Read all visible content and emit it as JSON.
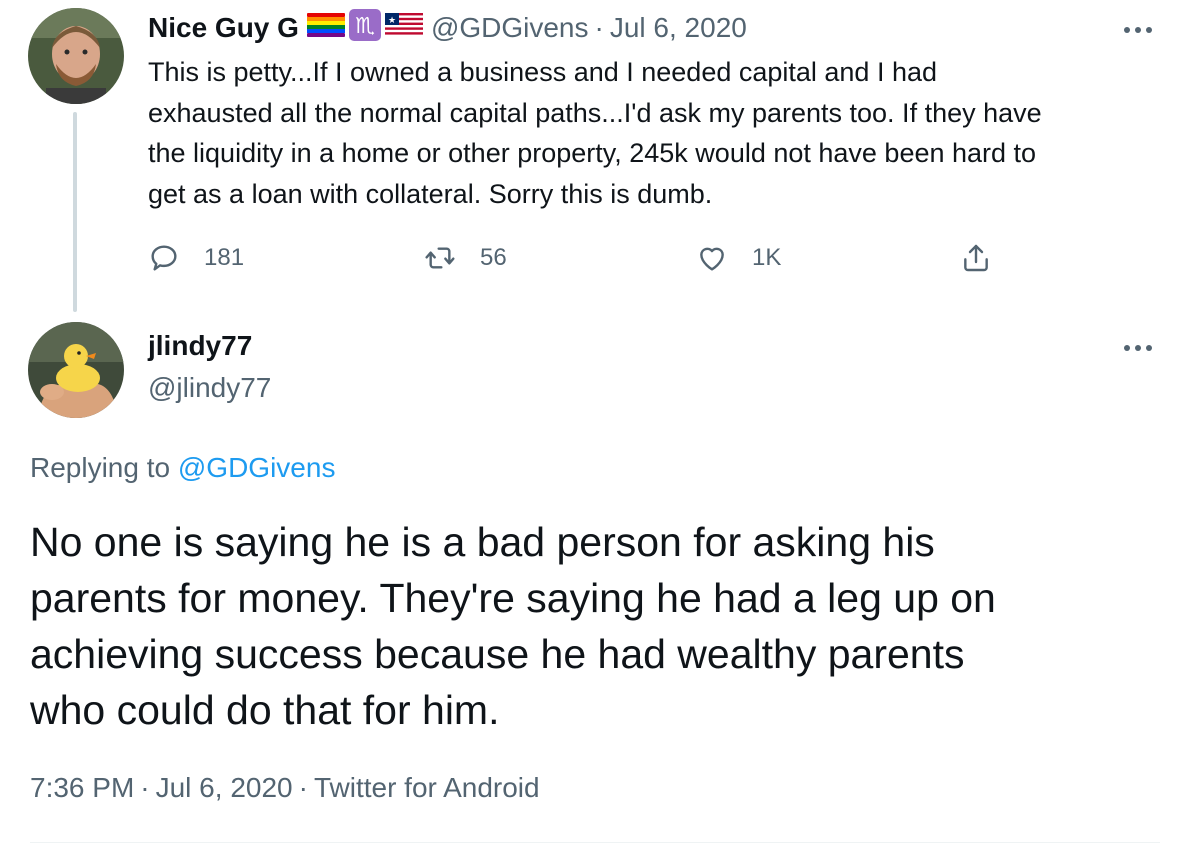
{
  "parent_tweet": {
    "display_name": "Nice Guy G",
    "badges": [
      "rainbow-flag-icon",
      "scorpio-icon",
      "liberia-flag-icon"
    ],
    "handle": "@GDGivens",
    "separator": "·",
    "date": "Jul 6, 2020",
    "lines": [
      "This is petty...If I owned a business and I needed capital and I had",
      "exhausted all the normal capital paths...I'd ask my parents too. If they have",
      "the liquidity in a home or other property, 245k would not have been hard to",
      "get as a loan with collateral. Sorry this is dumb."
    ],
    "actions": {
      "reply_count": "181",
      "retweet_count": "56",
      "like_count": "1K"
    }
  },
  "focal_tweet": {
    "display_name": "jlindy77",
    "handle": "@jlindy77",
    "replying_prefix": "Replying to",
    "replying_to": "@GDGivens",
    "lines": [
      "No one is saying he is a bad person for asking his",
      "parents for money. They're saying he had a leg up on",
      "achieving success because he had wealthy parents",
      "who could do that for him."
    ],
    "time": "7:36 PM",
    "separator": "·",
    "date": "Jul 6, 2020",
    "source": "Twitter for Android"
  },
  "colors": {
    "text_primary": "#0f1419",
    "text_secondary": "#536471",
    "link": "#1d9bf0",
    "thread_line": "#cfd9de"
  }
}
